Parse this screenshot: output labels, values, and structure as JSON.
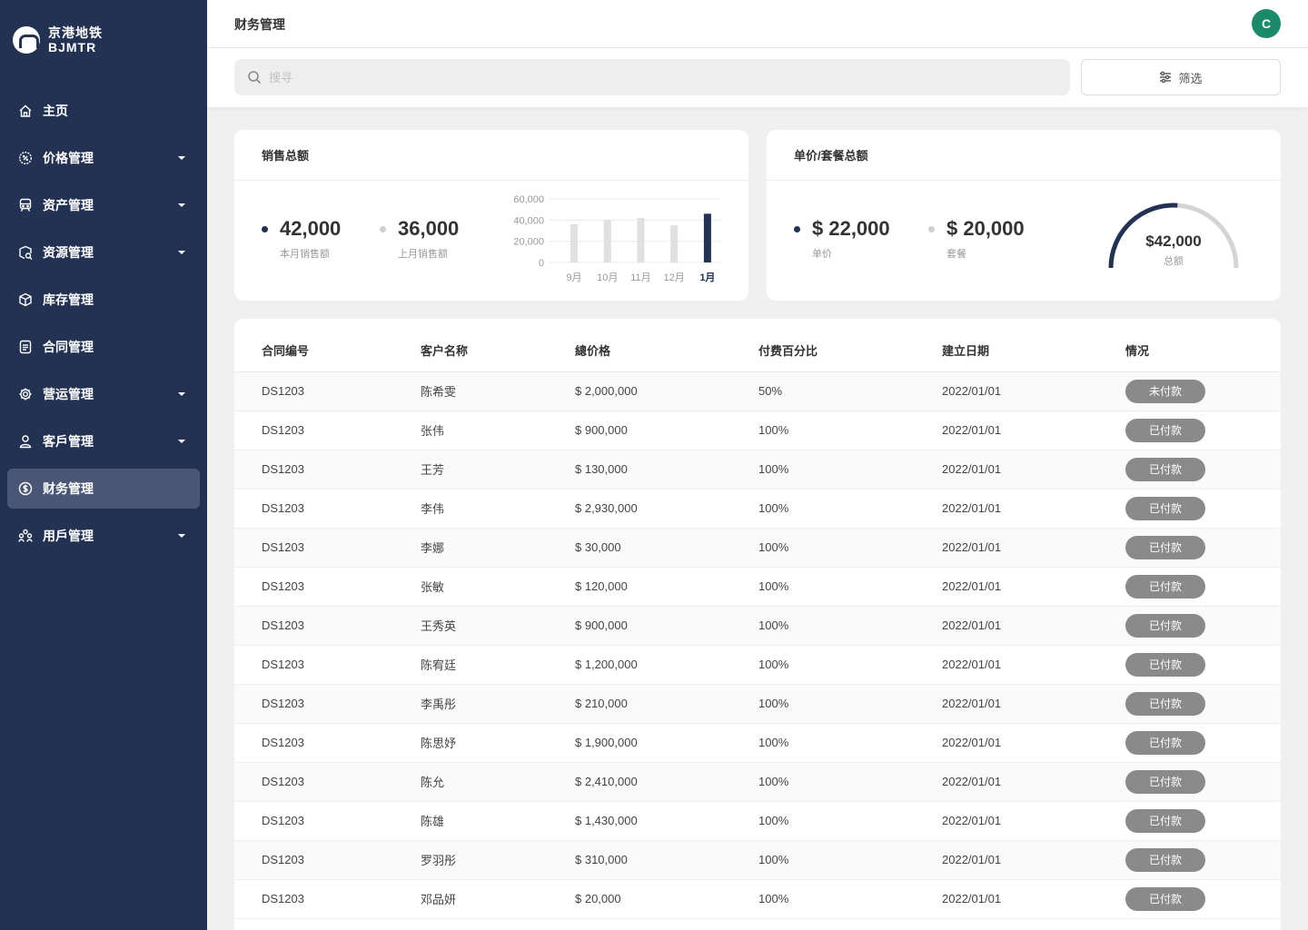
{
  "brand": {
    "cn": "京港地铁",
    "en": "BJMTR"
  },
  "nav": [
    {
      "label": "主页",
      "icon": "home-icon",
      "caret": false,
      "active": false
    },
    {
      "label": "价格管理",
      "icon": "price-tag-icon",
      "caret": true,
      "active": false
    },
    {
      "label": "资产管理",
      "icon": "train-icon",
      "caret": true,
      "active": false
    },
    {
      "label": "资源管理",
      "icon": "resource-search-icon",
      "caret": true,
      "active": false
    },
    {
      "label": "库存管理",
      "icon": "box-icon",
      "caret": false,
      "active": false
    },
    {
      "label": "合同管理",
      "icon": "document-icon",
      "caret": false,
      "active": false
    },
    {
      "label": "营运管理",
      "icon": "gear-icon",
      "caret": true,
      "active": false
    },
    {
      "label": "客戶管理",
      "icon": "user-icon",
      "caret": true,
      "active": false
    },
    {
      "label": "财务管理",
      "icon": "dollar-circle-icon",
      "caret": false,
      "active": true
    },
    {
      "label": "用戶管理",
      "icon": "users-group-icon",
      "caret": true,
      "active": false
    }
  ],
  "header": {
    "title": "财务管理",
    "avatar": "C"
  },
  "search": {
    "placeholder": "搜寻",
    "value": ""
  },
  "filter": {
    "label": "筛选"
  },
  "sales_card": {
    "title": "销售总额",
    "current": {
      "value": "42,000",
      "label": "本月销售额",
      "color": "#233252"
    },
    "previous": {
      "value": "36,000",
      "label": "上月销售额",
      "color": "#cfcfcf"
    }
  },
  "price_card": {
    "title": "单价/套餐总额",
    "unit": {
      "value": "$ 22,000",
      "label": "单价",
      "color": "#233252"
    },
    "package": {
      "value": "$ 20,000",
      "label": "套餐",
      "color": "#cfcfcf"
    },
    "gauge": {
      "value": "$42,000",
      "label": "总额",
      "fraction": 0.52
    }
  },
  "chart_data": {
    "type": "bar",
    "categories": [
      "9月",
      "10月",
      "11月",
      "12月",
      "1月"
    ],
    "values": [
      36000,
      40000,
      42000,
      35000,
      46000
    ],
    "highlight_index": 4,
    "ylim": [
      0,
      60000
    ],
    "yticks": [
      "0",
      "20,000",
      "40,000",
      "60,000"
    ],
    "ytick_values": [
      0,
      20000,
      40000,
      60000
    ],
    "grid": true,
    "colors": {
      "bar": "#e0e0e0",
      "highlight": "#233252"
    }
  },
  "table": {
    "headers": [
      "合同编号",
      "客户名称",
      "總价格",
      "付费百分比",
      "建立日期",
      "情况"
    ],
    "rows": [
      [
        "DS1203",
        "陈希雯",
        "$ 2,000,000",
        "50%",
        "2022/01/01",
        "未付款"
      ],
      [
        "DS1203",
        "张伟",
        "$ 900,000",
        "100%",
        "2022/01/01",
        "已付款"
      ],
      [
        "DS1203",
        "王芳",
        "$ 130,000",
        "100%",
        "2022/01/01",
        "已付款"
      ],
      [
        "DS1203",
        "李伟",
        "$ 2,930,000",
        "100%",
        "2022/01/01",
        "已付款"
      ],
      [
        "DS1203",
        "李娜",
        "$ 30,000",
        "100%",
        "2022/01/01",
        "已付款"
      ],
      [
        "DS1203",
        "张敏",
        "$ 120,000",
        "100%",
        "2022/01/01",
        "已付款"
      ],
      [
        "DS1203",
        "王秀英",
        "$ 900,000",
        "100%",
        "2022/01/01",
        "已付款"
      ],
      [
        "DS1203",
        "陈宥廷",
        "$ 1,200,000",
        "100%",
        "2022/01/01",
        "已付款"
      ],
      [
        "DS1203",
        "李禹彤",
        "$ 210,000",
        "100%",
        "2022/01/01",
        "已付款"
      ],
      [
        "DS1203",
        "陈思妤",
        "$ 1,900,000",
        "100%",
        "2022/01/01",
        "已付款"
      ],
      [
        "DS1203",
        "陈允",
        "$ 2,410,000",
        "100%",
        "2022/01/01",
        "已付款"
      ],
      [
        "DS1203",
        "陈雄",
        "$ 1,430,000",
        "100%",
        "2022/01/01",
        "已付款"
      ],
      [
        "DS1203",
        "罗羽彤",
        "$ 310,000",
        "100%",
        "2022/01/01",
        "已付款"
      ],
      [
        "DS1203",
        "邓品妍",
        "$ 20,000",
        "100%",
        "2022/01/01",
        "已付款"
      ]
    ]
  }
}
